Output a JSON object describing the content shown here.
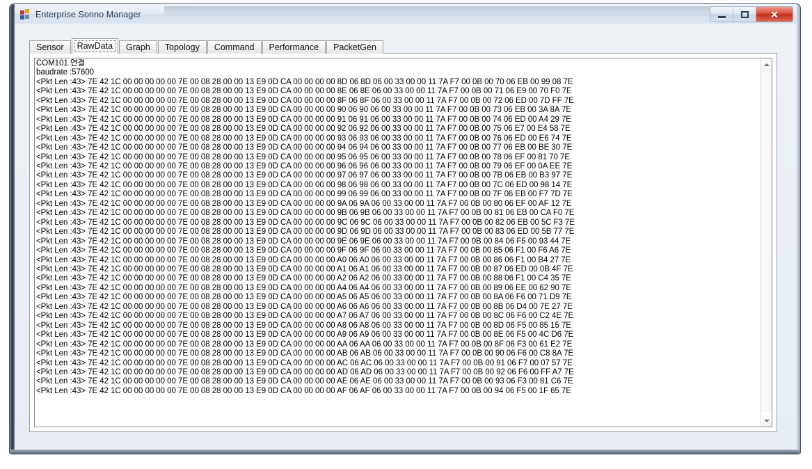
{
  "window": {
    "title": "Enterprise Sonno Manager",
    "icon": "app-icon",
    "buttons": {
      "minimize": "–",
      "maximize": "❐",
      "close": "✕"
    }
  },
  "tabs": [
    {
      "label": "Sensor",
      "selected": false
    },
    {
      "label": "RawData",
      "selected": true
    },
    {
      "label": "Graph",
      "selected": false
    },
    {
      "label": "Topology",
      "selected": false
    },
    {
      "label": "Command",
      "selected": false
    },
    {
      "label": "Performance",
      "selected": false
    },
    {
      "label": "PacketGen",
      "selected": false
    }
  ],
  "raw_data": {
    "status_lines": [
      "COM101 연결",
      "baudrate :57600"
    ],
    "packet_prefix": "<Pkt Len :43> 7E 42 1C 00 00 00 00 00 7E 00 08 28 00 00 13 E9 0D CA 00 00 00 00 ",
    "packet_middle": " 06 00 33 00 00 11 7A F7 00 0B 00 ",
    "packet_suffix": " 7E",
    "packets": [
      {
        "seq": "8D",
        "seq2": "8D",
        "idx": "70",
        "v1": "06",
        "v2": "EB",
        "v3": "00",
        "crc1": "99",
        "crc2": "08"
      },
      {
        "seq": "8E",
        "seq2": "8E",
        "idx": "71",
        "v1": "06",
        "v2": "E9",
        "v3": "00",
        "crc1": "70",
        "crc2": "F0"
      },
      {
        "seq": "8F",
        "seq2": "8F",
        "idx": "72",
        "v1": "06",
        "v2": "ED",
        "v3": "00",
        "crc1": "7D",
        "crc2": "FF"
      },
      {
        "seq": "90",
        "seq2": "90",
        "idx": "73",
        "v1": "06",
        "v2": "EB",
        "v3": "00",
        "crc1": "3A",
        "crc2": "8A"
      },
      {
        "seq": "91",
        "seq2": "91",
        "idx": "74",
        "v1": "06",
        "v2": "ED",
        "v3": "00",
        "crc1": "A4",
        "crc2": "29"
      },
      {
        "seq": "92",
        "seq2": "92",
        "idx": "75",
        "v1": "06",
        "v2": "E7",
        "v3": "00",
        "crc1": "E4",
        "crc2": "58"
      },
      {
        "seq": "93",
        "seq2": "93",
        "idx": "76",
        "v1": "06",
        "v2": "ED",
        "v3": "00",
        "crc1": "E6",
        "crc2": "74"
      },
      {
        "seq": "94",
        "seq2": "94",
        "idx": "77",
        "v1": "06",
        "v2": "EB",
        "v3": "00",
        "crc1": "BE",
        "crc2": "30"
      },
      {
        "seq": "95",
        "seq2": "95",
        "idx": "78",
        "v1": "06",
        "v2": "EF",
        "v3": "00",
        "crc1": "81",
        "crc2": "70"
      },
      {
        "seq": "96",
        "seq2": "96",
        "idx": "79",
        "v1": "06",
        "v2": "EF",
        "v3": "00",
        "crc1": "0A",
        "crc2": "EE"
      },
      {
        "seq": "97",
        "seq2": "97",
        "idx": "7B",
        "v1": "06",
        "v2": "EB",
        "v3": "00",
        "crc1": "B3",
        "crc2": "97"
      },
      {
        "seq": "98",
        "seq2": "98",
        "idx": "7C",
        "v1": "06",
        "v2": "ED",
        "v3": "00",
        "crc1": "98",
        "crc2": "14"
      },
      {
        "seq": "99",
        "seq2": "99",
        "idx": "7F",
        "v1": "06",
        "v2": "EB",
        "v3": "00",
        "crc1": "F7",
        "crc2": "7D"
      },
      {
        "seq": "9A",
        "seq2": "9A",
        "idx": "80",
        "v1": "06",
        "v2": "EF",
        "v3": "00",
        "crc1": "AF",
        "crc2": "12"
      },
      {
        "seq": "9B",
        "seq2": "9B",
        "idx": "81",
        "v1": "06",
        "v2": "EB",
        "v3": "00",
        "crc1": "CA",
        "crc2": "F0"
      },
      {
        "seq": "9C",
        "seq2": "9C",
        "idx": "82",
        "v1": "06",
        "v2": "EB",
        "v3": "00",
        "crc1": "5C",
        "crc2": "F3"
      },
      {
        "seq": "9D",
        "seq2": "9D",
        "idx": "83",
        "v1": "06",
        "v2": "ED",
        "v3": "00",
        "crc1": "5B",
        "crc2": "77"
      },
      {
        "seq": "9E",
        "seq2": "9E",
        "idx": "84",
        "v1": "06",
        "v2": "F5",
        "v3": "00",
        "crc1": "93",
        "crc2": "44"
      },
      {
        "seq": "9F",
        "seq2": "9F",
        "idx": "85",
        "v1": "06",
        "v2": "F1",
        "v3": "00",
        "crc1": "F6",
        "crc2": "A6"
      },
      {
        "seq": "A0",
        "seq2": "A0",
        "idx": "86",
        "v1": "06",
        "v2": "F1",
        "v3": "00",
        "crc1": "B4",
        "crc2": "27"
      },
      {
        "seq": "A1",
        "seq2": "A1",
        "idx": "87",
        "v1": "06",
        "v2": "ED",
        "v3": "00",
        "crc1": "0B",
        "crc2": "4F"
      },
      {
        "seq": "A2",
        "seq2": "A2",
        "idx": "88",
        "v1": "06",
        "v2": "F1",
        "v3": "00",
        "crc1": "C4",
        "crc2": "35"
      },
      {
        "seq": "A4",
        "seq2": "A4",
        "idx": "89",
        "v1": "06",
        "v2": "EE",
        "v3": "00",
        "crc1": "62",
        "crc2": "90"
      },
      {
        "seq": "A5",
        "seq2": "A5",
        "idx": "8A",
        "v1": "06",
        "v2": "F6",
        "v3": "00",
        "crc1": "71",
        "crc2": "D9"
      },
      {
        "seq": "A6",
        "seq2": "A6",
        "idx": "8B",
        "v1": "06",
        "v2": "D4",
        "v3": "00",
        "crc1": "7E",
        "crc2": "27"
      },
      {
        "seq": "A7",
        "seq2": "A7",
        "idx": "8C",
        "v1": "06",
        "v2": "F6",
        "v3": "00",
        "crc1": "C2",
        "crc2": "4E"
      },
      {
        "seq": "A8",
        "seq2": "A8",
        "idx": "8D",
        "v1": "06",
        "v2": "F5",
        "v3": "00",
        "crc1": "85",
        "crc2": "15"
      },
      {
        "seq": "A9",
        "seq2": "A9",
        "idx": "8E",
        "v1": "06",
        "v2": "F5",
        "v3": "00",
        "crc1": "4C",
        "crc2": "D6"
      },
      {
        "seq": "AA",
        "seq2": "AA",
        "idx": "8F",
        "v1": "06",
        "v2": "F3",
        "v3": "00",
        "crc1": "61",
        "crc2": "E2"
      },
      {
        "seq": "AB",
        "seq2": "AB",
        "idx": "90",
        "v1": "06",
        "v2": "F6",
        "v3": "00",
        "crc1": "C8",
        "crc2": "8A"
      },
      {
        "seq": "AC",
        "seq2": "AC",
        "idx": "91",
        "v1": "06",
        "v2": "F7",
        "v3": "00",
        "crc1": "07",
        "crc2": "57"
      },
      {
        "seq": "AD",
        "seq2": "AD",
        "idx": "92",
        "v1": "06",
        "v2": "F6",
        "v3": "00",
        "crc1": "FF",
        "crc2": "A7"
      },
      {
        "seq": "AE",
        "seq2": "AE",
        "idx": "93",
        "v1": "06",
        "v2": "F3",
        "v3": "00",
        "crc1": "81",
        "crc2": "C6"
      },
      {
        "seq": "AF",
        "seq2": "AF",
        "idx": "94",
        "v1": "06",
        "v2": "F5",
        "v3": "00",
        "crc1": "1F",
        "crc2": "65"
      }
    ]
  },
  "scrollbar": {
    "up_arrow": "scroll-up-arrow",
    "down_arrow": "scroll-down-arrow"
  },
  "colors": {
    "close_button": "#c2301c",
    "window_border": "#4a5563",
    "text": "#000000",
    "textbox_background": "#ffffff"
  }
}
